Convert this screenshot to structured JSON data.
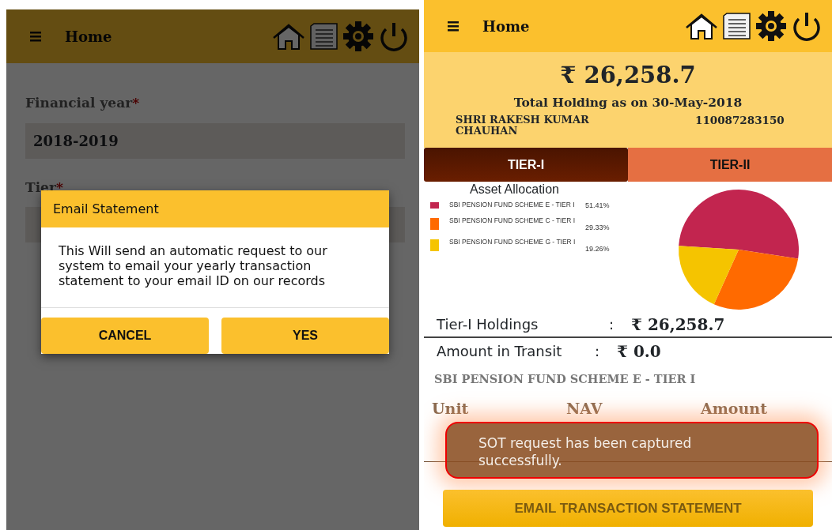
{
  "left_screen": {
    "app_bar": {
      "title": "Home"
    },
    "form": {
      "fields": [
        {
          "label": "Financial year",
          "required_mark": "*",
          "value": "2018-2019"
        },
        {
          "label": "Tier",
          "required_mark": "*"
        }
      ]
    },
    "dialog": {
      "title": "Email Statement",
      "message": "This Will send an automatic request to our system to email your yearly transaction statement to your email ID on our records",
      "buttons": [
        "CANCEL",
        "YES"
      ]
    }
  },
  "right_screen": {
    "app_bar": {
      "title": "Home"
    },
    "summary": {
      "total": "₹ 26,258.7",
      "caption": "Total Holding as on 30-May-2018",
      "name": "SHRI RAKESH KUMAR CHAUHAN",
      "account": "110087283150"
    },
    "tabs": [
      {
        "label": "TIER-I",
        "selected": true
      },
      {
        "label": "TIER-II",
        "selected": false
      }
    ],
    "allocation": {
      "title": "Asset Allocation",
      "legend": [
        {
          "percent": "51.41%",
          "color": "#c2254f"
        },
        {
          "percent": "29.33%",
          "color": "#ff6a00"
        },
        {
          "percent": "19.26%",
          "color": "#f5c400"
        }
      ],
      "chart_data": {
        "type": "pie",
        "categories": [
          "SBI PENSION FUND SCHEME E - TIER I",
          "SBI PENSION FUND SCHEME C - TIER I",
          "SBI PENSION FUND SCHEME G - TIER I"
        ],
        "values": [
          51.41,
          29.33,
          19.26
        ]
      }
    },
    "holdings": [
      {
        "label": "Tier-I Holdings",
        "separator": ":",
        "value": "₹ 26,258.7"
      },
      {
        "label": "Amount in Transit",
        "separator": ":",
        "value": "₹ 0.0"
      }
    ],
    "scheme_title": "SBI PENSION FUND SCHEME E - TIER I",
    "table_columns": [
      "Unit",
      "NAV",
      "Amount"
    ],
    "toast": "SOT request has been captured successfully.",
    "email_button": "EMAIL TRANSACTION STATEMENT"
  }
}
